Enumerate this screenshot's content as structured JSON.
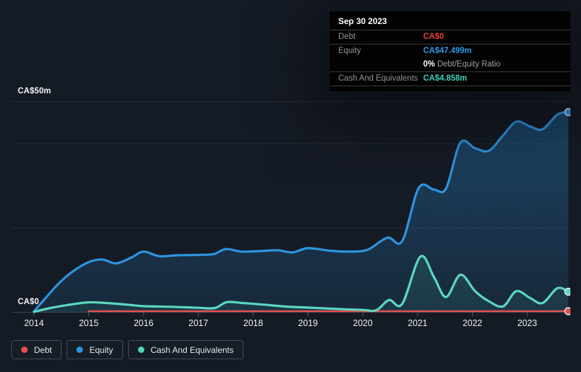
{
  "y_axis": {
    "top_label": "CA$50m",
    "bottom_label": "CA$0"
  },
  "tooltip": {
    "date": "Sep 30 2023",
    "debt_label": "Debt",
    "debt_value": "CA$0",
    "equity_label": "Equity",
    "equity_value": "CA$47.499m",
    "ratio_value": "0%",
    "ratio_label": " Debt/Equity Ratio",
    "cash_label": "Cash And Equivalents",
    "cash_value": "CA$4.858m"
  },
  "legend": {
    "items": [
      {
        "label": "Debt",
        "color": "#e8504c"
      },
      {
        "label": "Equity",
        "color": "#2e93e2"
      },
      {
        "label": "Cash And Equivalents",
        "color": "#4ed6bd"
      }
    ]
  },
  "colors": {
    "background": "#151b25",
    "gridline": "rgba(255,255,255,0.075)",
    "axis": "#3e4553",
    "debt": "#e0514e",
    "equity": "#2e95e0",
    "cash": "#5cd8c0"
  },
  "chart_data": {
    "type": "area",
    "title": "Debt, Equity and Cash And Equivalents history",
    "unit": "CA$ millions",
    "ylim": [
      0,
      50
    ],
    "grid_values": [
      50,
      40,
      20,
      0
    ],
    "x_ticks": [
      2014,
      2015,
      2016,
      2017,
      2018,
      2019,
      2020,
      2021,
      2022,
      2023
    ],
    "x_end": 2023.75,
    "series": [
      {
        "name": "Equity",
        "color": "#2e95e0",
        "final_value": "CA$47.499m",
        "points": [
          [
            2014.0,
            0.2
          ],
          [
            2014.2,
            3.2
          ],
          [
            2014.45,
            6.8
          ],
          [
            2014.7,
            9.6
          ],
          [
            2015.0,
            11.9
          ],
          [
            2015.25,
            12.5
          ],
          [
            2015.5,
            11.6
          ],
          [
            2015.78,
            13.0
          ],
          [
            2016.0,
            14.4
          ],
          [
            2016.28,
            13.3
          ],
          [
            2016.6,
            13.5
          ],
          [
            2017.0,
            13.6
          ],
          [
            2017.28,
            13.8
          ],
          [
            2017.5,
            15.0
          ],
          [
            2017.78,
            14.4
          ],
          [
            2018.1,
            14.5
          ],
          [
            2018.45,
            14.7
          ],
          [
            2018.72,
            14.2
          ],
          [
            2019.0,
            15.2
          ],
          [
            2019.4,
            14.6
          ],
          [
            2019.8,
            14.4
          ],
          [
            2020.1,
            14.9
          ],
          [
            2020.45,
            17.7
          ],
          [
            2020.72,
            16.9
          ],
          [
            2021.02,
            29.5
          ],
          [
            2021.3,
            29.1
          ],
          [
            2021.52,
            29.4
          ],
          [
            2021.78,
            40.2
          ],
          [
            2022.05,
            38.9
          ],
          [
            2022.3,
            38.3
          ],
          [
            2022.55,
            41.8
          ],
          [
            2022.8,
            45.2
          ],
          [
            2023.05,
            44.1
          ],
          [
            2023.28,
            43.4
          ],
          [
            2023.55,
            46.9
          ],
          [
            2023.75,
            47.5
          ]
        ]
      },
      {
        "name": "Cash And Equivalents",
        "color": "#5cd8c0",
        "final_value": "CA$4.858m",
        "points": [
          [
            2014.0,
            0.1
          ],
          [
            2014.3,
            1.0
          ],
          [
            2014.65,
            1.8
          ],
          [
            2015.0,
            2.35
          ],
          [
            2015.3,
            2.2
          ],
          [
            2015.7,
            1.8
          ],
          [
            2016.0,
            1.45
          ],
          [
            2016.5,
            1.3
          ],
          [
            2017.0,
            1.05
          ],
          [
            2017.3,
            1.0
          ],
          [
            2017.52,
            2.4
          ],
          [
            2017.8,
            2.2
          ],
          [
            2018.2,
            1.8
          ],
          [
            2018.6,
            1.35
          ],
          [
            2019.0,
            1.1
          ],
          [
            2019.5,
            0.8
          ],
          [
            2020.0,
            0.55
          ],
          [
            2020.25,
            0.5
          ],
          [
            2020.48,
            2.9
          ],
          [
            2020.72,
            2.0
          ],
          [
            2021.05,
            13.2
          ],
          [
            2021.3,
            8.3
          ],
          [
            2021.52,
            3.6
          ],
          [
            2021.78,
            8.9
          ],
          [
            2022.05,
            5.0
          ],
          [
            2022.3,
            2.6
          ],
          [
            2022.56,
            1.4
          ],
          [
            2022.8,
            5.0
          ],
          [
            2023.05,
            3.4
          ],
          [
            2023.28,
            2.2
          ],
          [
            2023.55,
            5.7
          ],
          [
            2023.75,
            4.86
          ]
        ]
      },
      {
        "name": "Debt",
        "color": "#e0514e",
        "final_value": "CA$0",
        "points": [
          [
            2015.0,
            0
          ],
          [
            2016.5,
            0
          ],
          [
            2018.0,
            0
          ],
          [
            2019.5,
            0
          ],
          [
            2021.0,
            0
          ],
          [
            2022.5,
            0
          ],
          [
            2023.75,
            0
          ]
        ]
      }
    ]
  }
}
